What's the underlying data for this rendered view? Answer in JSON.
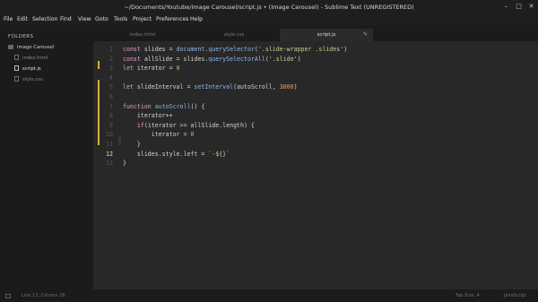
{
  "window": {
    "title": "~/Documents/Youtube/Image Carousel/script.js • (Image Carousel) - Sublime Text (UNREGISTERED)",
    "controls": {
      "minimize": "–",
      "maximize": "□",
      "close": "✕"
    }
  },
  "menu": [
    "File",
    "Edit",
    "Selection",
    "Find",
    "View",
    "Goto",
    "Tools",
    "Project",
    "Preferences",
    "Help"
  ],
  "sidebar": {
    "header": "FOLDERS",
    "folder": "Image Carousel",
    "files": [
      {
        "name": "index.html",
        "icon": "file-icon",
        "active": false
      },
      {
        "name": "script.js",
        "icon": "file-icon",
        "active": true
      },
      {
        "name": "style.css",
        "icon": "file-icon",
        "active": false
      }
    ]
  },
  "tabs": [
    {
      "label": "index.html",
      "active": false
    },
    {
      "label": "style.css",
      "active": false
    },
    {
      "label": "script.js",
      "active": true,
      "modified_marker": "✎"
    }
  ],
  "editor": {
    "current_line": 12,
    "lines": [
      {
        "num": "1",
        "tokens": [
          [
            "kw",
            "const"
          ],
          [
            "plain",
            " slides = "
          ],
          [
            "fn",
            "document"
          ],
          [
            "plain",
            "."
          ],
          [
            "fn",
            "querySelector"
          ],
          [
            "plain",
            "("
          ],
          [
            "str",
            "'.slide-wrapper .slides'"
          ],
          [
            "plain",
            ")"
          ]
        ]
      },
      {
        "num": "2",
        "tokens": [
          [
            "kw",
            "const"
          ],
          [
            "plain",
            " allSlide = slides."
          ],
          [
            "fn",
            "querySelectorAll"
          ],
          [
            "plain",
            "("
          ],
          [
            "str",
            "'.slide'"
          ],
          [
            "plain",
            ")"
          ]
        ]
      },
      {
        "num": "3",
        "tokens": [
          [
            "kw",
            "let"
          ],
          [
            "plain",
            " iterator = "
          ],
          [
            "num",
            "0"
          ]
        ]
      },
      {
        "num": "4",
        "tokens": []
      },
      {
        "num": "5",
        "tokens": [
          [
            "kw",
            "let"
          ],
          [
            "plain",
            " slideInterval = "
          ],
          [
            "fn",
            "setInterval"
          ],
          [
            "plain",
            "(autoScroll, "
          ],
          [
            "num",
            "3000"
          ],
          [
            "plain",
            ")"
          ]
        ]
      },
      {
        "num": "6",
        "tokens": []
      },
      {
        "num": "7",
        "tokens": [
          [
            "kw",
            "function"
          ],
          [
            "plain",
            " "
          ],
          [
            "fn",
            "autoScroll"
          ],
          [
            "plain",
            "() {"
          ]
        ]
      },
      {
        "num": "8",
        "tokens": [
          [
            "plain",
            "    iterator++"
          ]
        ]
      },
      {
        "num": "9",
        "tokens": [
          [
            "plain",
            "    "
          ],
          [
            "kw",
            "if"
          ],
          [
            "plain",
            "(iterator >= allSlide.length) {"
          ]
        ]
      },
      {
        "num": "10",
        "tokens": [
          [
            "plain",
            "        iterator = "
          ],
          [
            "num",
            "0"
          ]
        ]
      },
      {
        "num": "11",
        "tokens": [
          [
            "plain",
            "    }"
          ]
        ]
      },
      {
        "num": "12",
        "tokens": [
          [
            "plain",
            "    slides.style.left = "
          ],
          [
            "str",
            "`-${}`"
          ]
        ]
      },
      {
        "num": "13",
        "tokens": [
          [
            "plain",
            "}"
          ]
        ]
      }
    ]
  },
  "colors": {
    "keyword": "#e89bd0",
    "function": "#8fb7e8",
    "string": "#c2d68b",
    "number": "#e6a35a",
    "plain": "#d4d4d4",
    "modified_bar": "#d3b23a"
  },
  "statusbar": {
    "position": "Line 12, Column 28",
    "tab_size": "Tab Size: 4",
    "syntax": "JavaScript"
  }
}
